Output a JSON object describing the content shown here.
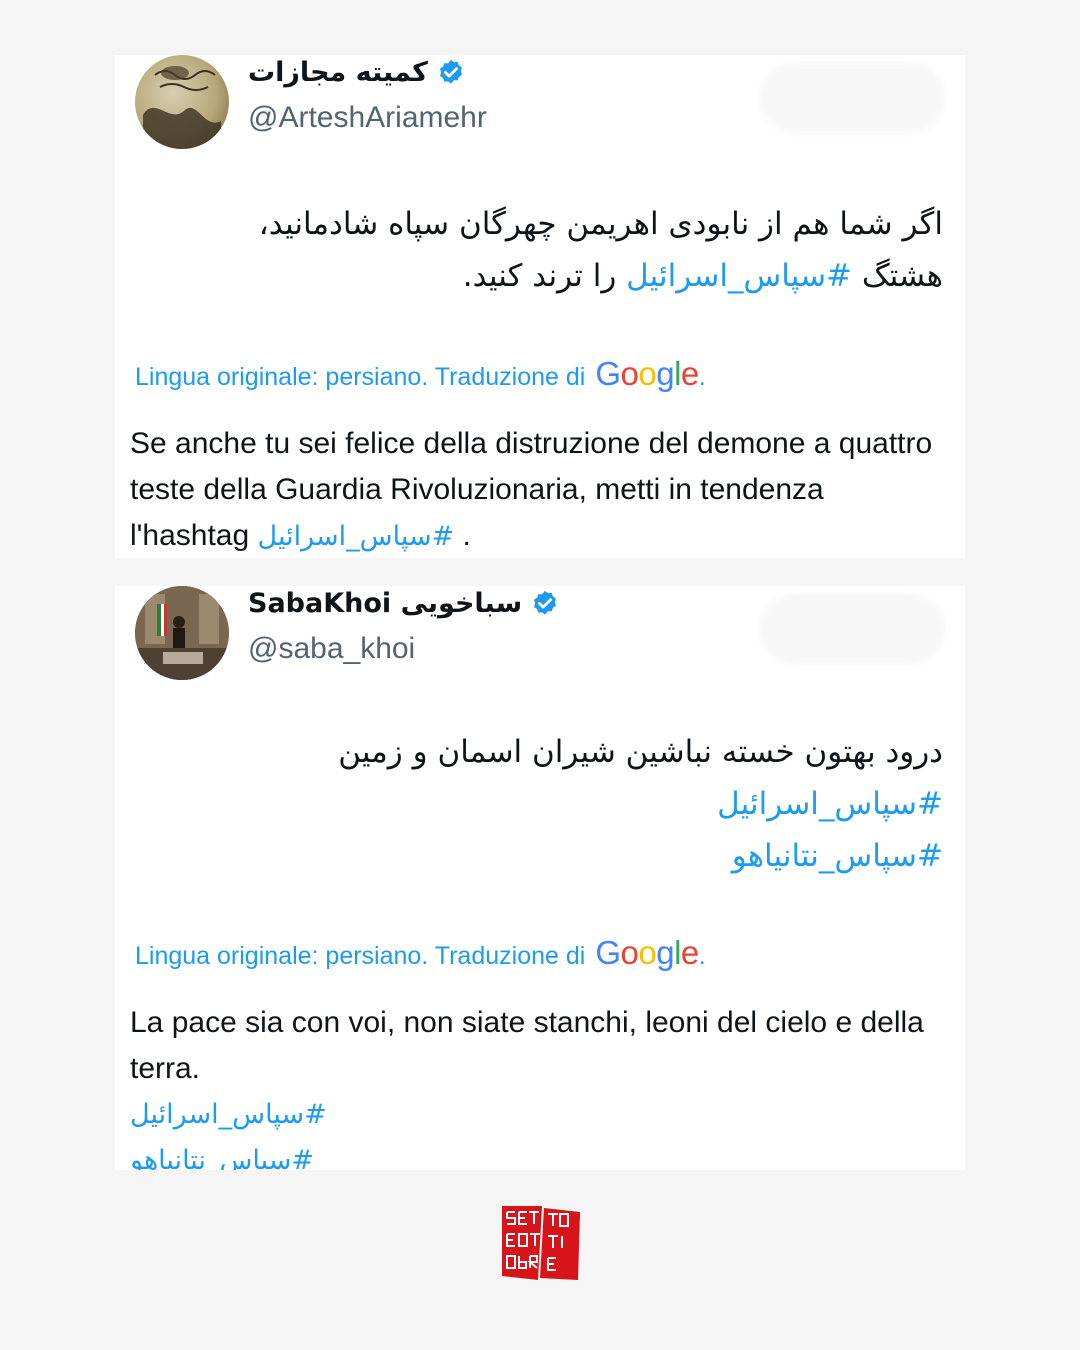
{
  "tweets": [
    {
      "display_name": "کمیته مجازات",
      "handle": "@ArteshAriamehr",
      "original_line1": "اگر شما هم از نابودی اهریمن چهرگان سپاه شادمانید،",
      "original_line2_pre": "هشتگ ",
      "original_line2_hash": "#سپاس_اسرائیل",
      "original_line2_post": " را ترند کنید.",
      "translation_note": "Lingua originale: persiano. Traduzione di",
      "translation_text": "Se anche tu sei felice della distruzione del demone a quattro teste della Guardia Rivoluzionaria, metti in tendenza l'hashtag",
      "translation_hash": "#سپاس_اسرائیل",
      "translation_end": " ."
    },
    {
      "display_name": "SabaKhoi سباخویی",
      "handle": "@saba_khoi",
      "original_line1": "درود بهتون خسته نباشین شیران اسمان و زمین",
      "hashtag1": "#سپاس_اسرائیل",
      "hashtag2": "#سپاس_نتانیاهو",
      "translation_note": "Lingua originale: persiano. Traduzione di",
      "translation_text": "La pace sia con voi, non siate stanchi, leoni del cielo e della terra.",
      "translation_hash1": "#سپاس_اسرائیل",
      "translation_hash2": "#سپاس_نتانیاهو"
    }
  ],
  "google_logo": {
    "g1": "G",
    "o1": "o",
    "o2": "o",
    "g2": "g",
    "l": "l",
    "e": "e",
    "dot": "."
  },
  "colors": {
    "link": "#1d9bf0",
    "text": "#0f1419",
    "muted": "#536471",
    "verified": "#1d9bf0",
    "logo_red": "#d7141a"
  },
  "icons": {
    "verified": "verified-badge-icon"
  },
  "logo": {
    "line1": "SETTE",
    "line2": "OTTOBRE"
  }
}
